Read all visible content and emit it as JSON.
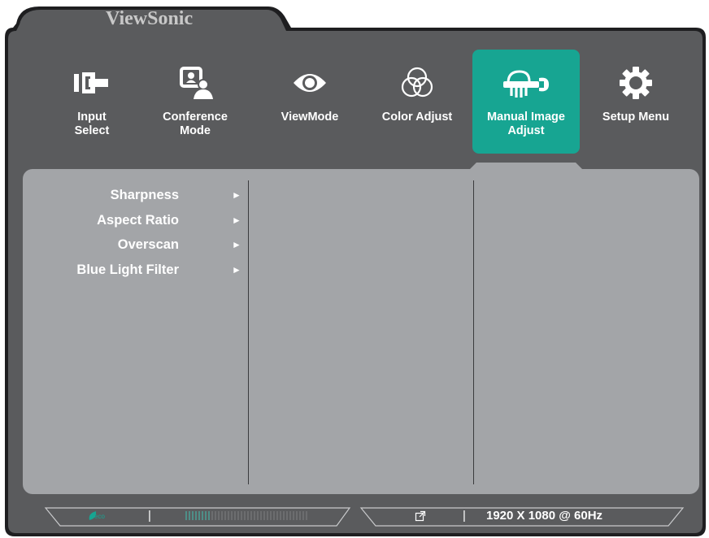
{
  "brand": "ViewSonic",
  "tabs": [
    {
      "id": "input-select",
      "label": "Input\nSelect",
      "icon": "input-plug-icon",
      "active": false
    },
    {
      "id": "conference-mode",
      "label": "Conference\nMode",
      "icon": "conference-person-icon",
      "active": false
    },
    {
      "id": "viewmode",
      "label": "ViewMode",
      "icon": "eye-icon",
      "active": false
    },
    {
      "id": "color-adjust",
      "label": "Color Adjust",
      "icon": "color-circles-icon",
      "active": false
    },
    {
      "id": "manual-image-adjust",
      "label": "Manual Image\nAdjust",
      "icon": "hand-wrench-icon",
      "active": true
    },
    {
      "id": "setup-menu",
      "label": "Setup Menu",
      "icon": "gear-icon",
      "active": false
    }
  ],
  "menu": {
    "items": [
      {
        "label": "Sharpness",
        "arrow": "►"
      },
      {
        "label": "Aspect Ratio",
        "arrow": "►"
      },
      {
        "label": "Overscan",
        "arrow": "►"
      },
      {
        "label": "Blue Light Filter",
        "arrow": "►"
      }
    ]
  },
  "status": {
    "eco_label": "eco",
    "separator": "|",
    "level_fraction": 0.2,
    "resolution": "1920 X 1080 @ 60Hz"
  },
  "colors": {
    "bezel": "#5a5b5d",
    "panel": "#a3a5a8",
    "accent": "#17a592"
  }
}
